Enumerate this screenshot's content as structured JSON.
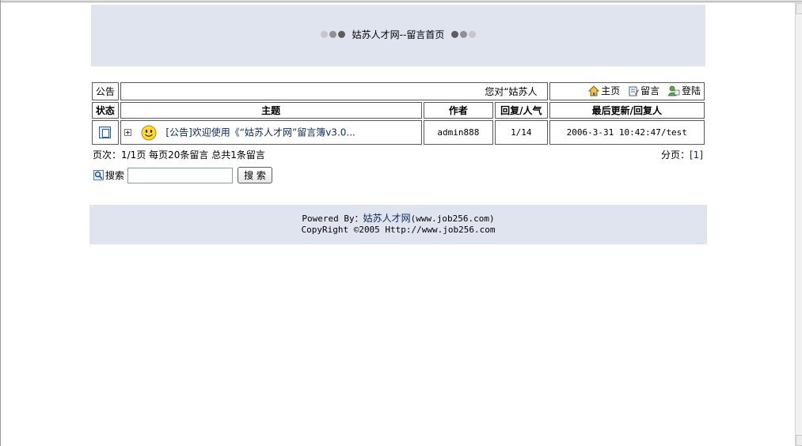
{
  "header": {
    "title": "姑苏人才网--留言首页"
  },
  "bar": {
    "announce_label": "公告",
    "marquee_text": "您对“姑苏人",
    "links": [
      {
        "label": "主页",
        "icon": "home-icon"
      },
      {
        "label": "留言",
        "icon": "compose-icon"
      },
      {
        "label": "登陆",
        "icon": "login-icon"
      }
    ]
  },
  "table": {
    "columns": [
      "状态",
      "主题",
      "作者",
      "回复/人气",
      "最后更新/回复人"
    ],
    "rows": [
      {
        "topic": "[公告]欢迎使用《“姑苏人才网”留言簿v3.0...",
        "author": "admin888",
        "reply_views": "1/14",
        "last_update": "2006-3-31 10:42:47/test"
      }
    ]
  },
  "pager": {
    "summary": "页次：1/1页 每页20条留言 总共1条留言",
    "paging_label": "分页：",
    "pages": "[1]"
  },
  "search": {
    "label": "搜索",
    "value": "",
    "button_label": "搜 索"
  },
  "footer": {
    "powered_prefix": "Powered By：",
    "brand": "姑苏人才网",
    "brand_url": "(www.job256.com)",
    "copyright": "CopyRight ©2005 Http://www.job256.com"
  },
  "colors": {
    "banner_bg": "#dfe4ee",
    "border": "#5a5a5a",
    "link": "#0b2a5a"
  }
}
